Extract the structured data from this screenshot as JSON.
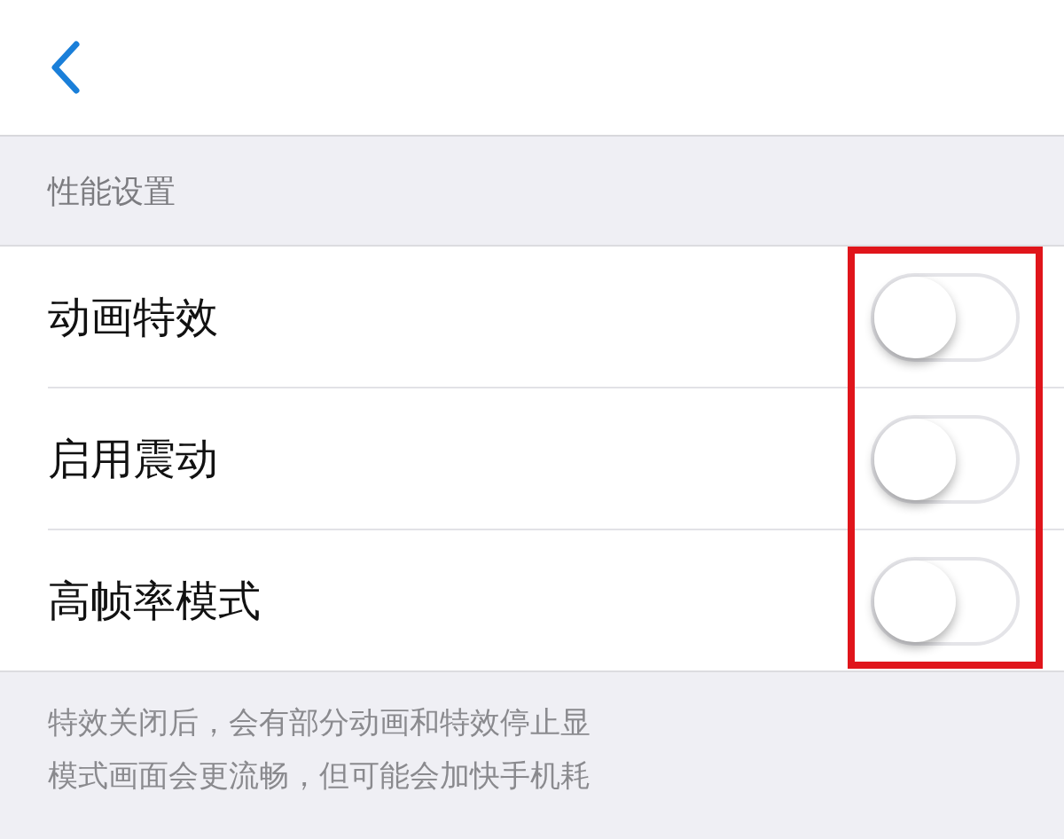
{
  "section": {
    "title": "性能设置"
  },
  "settings": [
    {
      "label": "动画特效",
      "on": false
    },
    {
      "label": "启用震动",
      "on": false
    },
    {
      "label": "高帧率模式",
      "on": false
    }
  ],
  "footnote_lines": [
    "特效关闭后，会有部分动画和特效停止显",
    "模式画面会更流畅，但可能会加快手机耗"
  ]
}
